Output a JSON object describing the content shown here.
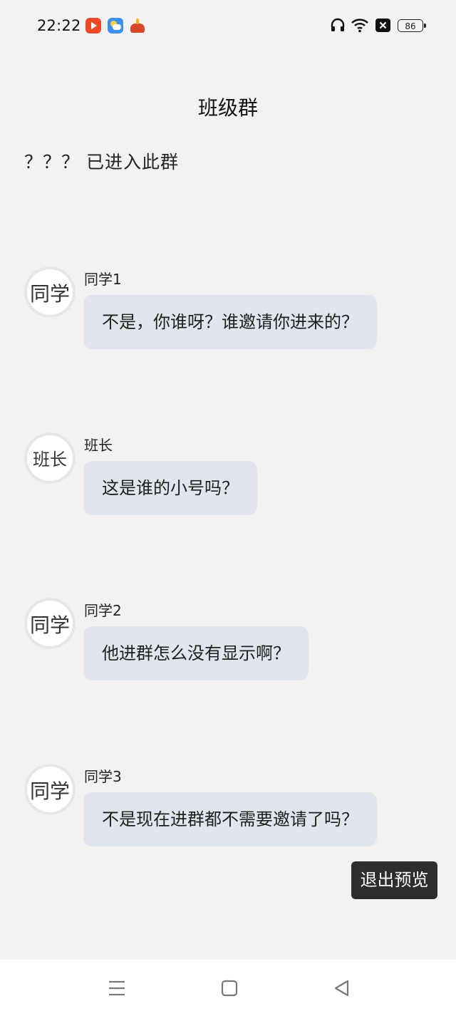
{
  "status_bar": {
    "time": "22:22",
    "notification_icons": [
      "video-app-icon",
      "weather-app-icon",
      "game-app-icon"
    ],
    "right_icons": [
      "headphone-icon",
      "wifi-icon",
      "close-box-icon"
    ],
    "battery_level": "86"
  },
  "header": {
    "title": "班级群"
  },
  "system_notice": "？？？ 已进入此群",
  "messages": [
    {
      "sender": "同学1",
      "avatar_text": "同学",
      "text": "不是，你谁呀？谁邀请你进来的？"
    },
    {
      "sender": "班长",
      "avatar_text": "班长",
      "text": "这是谁的小号吗？"
    },
    {
      "sender": "同学2",
      "avatar_text": "同学",
      "text": "他进群怎么没有显示啊？"
    },
    {
      "sender": "同学3",
      "avatar_text": "同学",
      "text": "不是现在进群都不需要邀请了吗？"
    }
  ],
  "exit_preview_label": "退出预览",
  "nav_bar": {
    "icons": [
      "menu-icon",
      "home-icon",
      "back-icon"
    ]
  },
  "colors": {
    "background": "#f2f2f2",
    "bubble": "#e1e6ee",
    "exit_button": "#2e2e2e"
  }
}
